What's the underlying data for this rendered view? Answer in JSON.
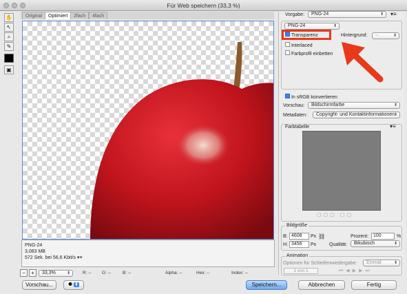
{
  "window": {
    "title": "Für Web speichern (33,3 %)"
  },
  "tabs": [
    {
      "label": "Original"
    },
    {
      "label": "Optimiert"
    },
    {
      "label": "2fach"
    },
    {
      "label": "4fach"
    }
  ],
  "preview_info": {
    "format": "PNG-24",
    "size": "3,083 MB",
    "time": "572 Sek. bei 56,6 Kbit/s"
  },
  "status": {
    "zoom": "33,3%",
    "r": "R: --",
    "g": "G: --",
    "b": "B: --",
    "alpha": "Alpha: --",
    "hex": "Hex: --",
    "index": "Index: --"
  },
  "buttons": {
    "preview": "Vorschau...",
    "save": "Speichern...",
    "cancel": "Abbrechen",
    "done": "Fertig"
  },
  "settings": {
    "preset_label": "Vorgabe:",
    "preset_value": "PNG-24",
    "format_value": "PNG-24",
    "transparency_label": "Transparenz",
    "matte_label": "Hintergrund:",
    "matte_value": "--",
    "interlaced_label": "Interlaced",
    "embed_profile_label": "Farbprofil einbetten",
    "convert_srgb_label": "In sRGB konvertieren",
    "preview_label": "Vorschau:",
    "preview_value": "Bildschirmfarbe",
    "metadata_label": "Metadaten:",
    "metadata_value": "Copyright- und Kontaktinformationen",
    "color_table_label": "Farbtabelle",
    "image_size_label": "Bildgröße",
    "w_label": "B:",
    "w_value": "4608",
    "h_label": "H:",
    "h_value": "3456",
    "px_unit": "Px",
    "percent_label": "Prozent:",
    "percent_value": "100",
    "percent_unit": "%",
    "quality_label": "Qualität:",
    "quality_value": "Bikubisch",
    "animation_label": "Animation",
    "loop_label": "Optionen für Schleifenwiedergabe:",
    "loop_value": "Einmal",
    "frame_counter": "1 von 1"
  },
  "colors": {
    "annotation": "#e8391b",
    "apple": "#c0141c",
    "selection": "#5c8ad6"
  }
}
